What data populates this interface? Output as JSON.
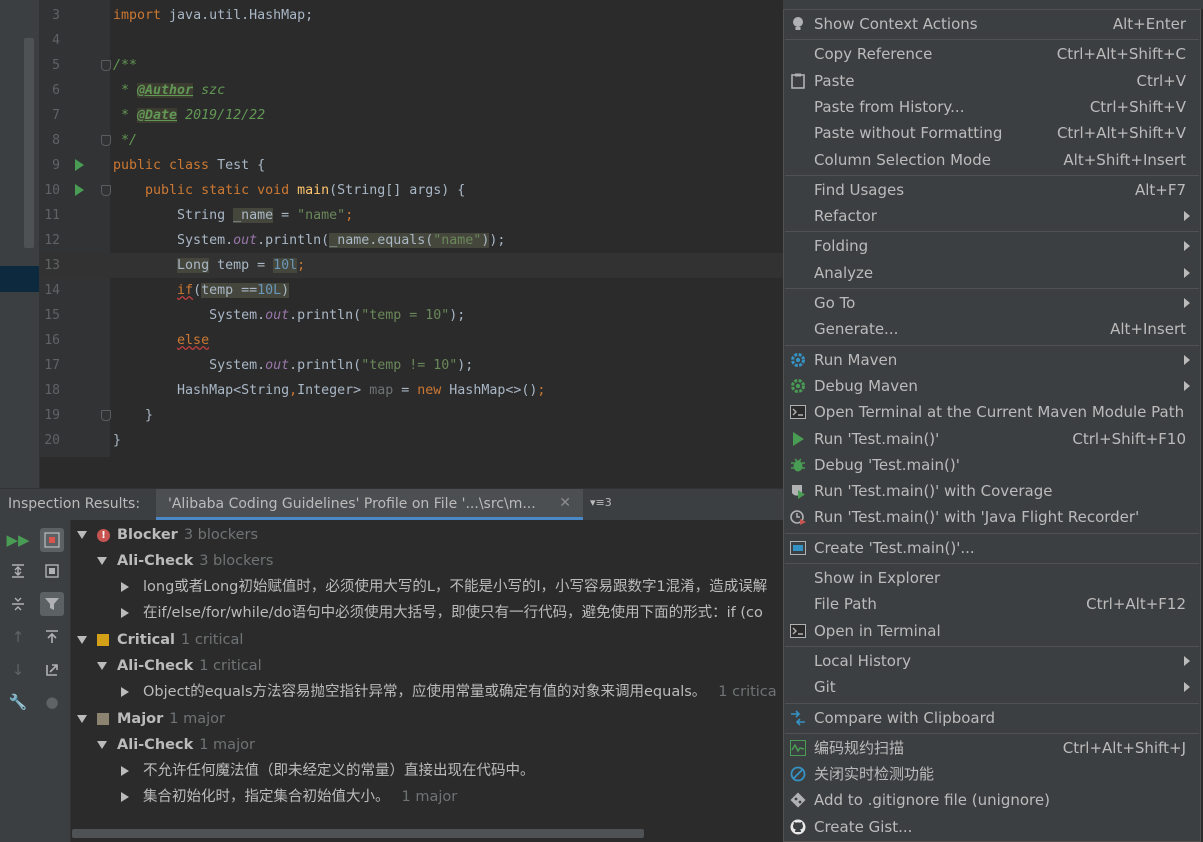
{
  "editor": {
    "lines": [
      {
        "n": "3",
        "segs": [
          [
            "kw",
            "import "
          ],
          [
            "",
            "java.util.HashMap;"
          ]
        ]
      },
      {
        "n": "4",
        "segs": []
      },
      {
        "n": "5",
        "fold": true,
        "segs": [
          [
            "cmt",
            "/**"
          ]
        ]
      },
      {
        "n": "6",
        "segs": [
          [
            "cmt",
            " * "
          ],
          [
            "tag",
            "@Author"
          ],
          [
            "cmt",
            " szc"
          ]
        ]
      },
      {
        "n": "7",
        "segs": [
          [
            "cmt",
            " * "
          ],
          [
            "tag",
            "@Date"
          ],
          [
            "cmt",
            " 2019/12/22"
          ]
        ]
      },
      {
        "n": "8",
        "fold": true,
        "segs": [
          [
            "cmt",
            " */"
          ]
        ]
      },
      {
        "n": "9",
        "run": true,
        "segs": [
          [
            "kw",
            "public class "
          ],
          [
            "",
            "Test {"
          ]
        ]
      },
      {
        "n": "10",
        "run": true,
        "fold": true,
        "segs": [
          [
            "",
            "    "
          ],
          [
            "kw",
            "public static void "
          ],
          [
            "fn",
            "main"
          ],
          [
            "",
            "(String[] args) {"
          ]
        ]
      },
      {
        "n": "11",
        "segs": [
          [
            "",
            "        String "
          ],
          [
            "warn-bg",
            "_name"
          ],
          [
            "",
            " = "
          ],
          [
            "str",
            "\"name\""
          ],
          [
            "kw",
            ";"
          ]
        ]
      },
      {
        "n": "12",
        "segs": [
          [
            "",
            "        System."
          ],
          [
            "fld",
            "out"
          ],
          [
            "",
            ".println("
          ],
          [
            "warn-bg",
            "_name.equals("
          ],
          [
            "str warn-bg",
            "\"name\""
          ],
          [
            "warn-bg",
            ")"
          ],
          [
            "",
            ");"
          ]
        ]
      },
      {
        "n": "13",
        "caret": true,
        "segs": [
          [
            "",
            "        "
          ],
          [
            "warn-bg",
            "Long"
          ],
          [
            "",
            " temp = "
          ],
          [
            "num warn-bg",
            "10l"
          ],
          [
            "kw",
            ";"
          ]
        ]
      },
      {
        "n": "14",
        "segs": [
          [
            "",
            "        "
          ],
          [
            "kw squig",
            "if"
          ],
          [
            "",
            "("
          ],
          [
            "warn-bg",
            "temp =="
          ],
          [
            "num warn-bg",
            "10L"
          ],
          [
            "warn-bg",
            ")"
          ]
        ]
      },
      {
        "n": "15",
        "segs": [
          [
            "",
            "            System."
          ],
          [
            "fld",
            "out"
          ],
          [
            "",
            ".println("
          ],
          [
            "str",
            "\"temp = 10\""
          ],
          [
            "",
            ");"
          ]
        ]
      },
      {
        "n": "16",
        "segs": [
          [
            "",
            "        "
          ],
          [
            "kw squig",
            "else"
          ]
        ]
      },
      {
        "n": "17",
        "segs": [
          [
            "",
            "            System."
          ],
          [
            "fld",
            "out"
          ],
          [
            "",
            ".println("
          ],
          [
            "str",
            "\"temp != 10\""
          ],
          [
            "",
            ");"
          ]
        ]
      },
      {
        "n": "18",
        "segs": [
          [
            "",
            "        HashMap<String"
          ],
          [
            "kw",
            ","
          ],
          [
            "",
            "Integer> "
          ],
          [
            "gray",
            "map"
          ],
          [
            "",
            " = "
          ],
          [
            "kw",
            "new "
          ],
          [
            "",
            "HashMap<>"
          ],
          [
            "",
            "()"
          ],
          [
            "kw",
            ";"
          ]
        ]
      },
      {
        "n": "19",
        "fold": true,
        "segs": [
          [
            "",
            "    }"
          ]
        ]
      },
      {
        "n": "20",
        "segs": [
          [
            "",
            "}"
          ]
        ]
      }
    ]
  },
  "inspection": {
    "header_label": "Inspection Results:",
    "tab_title": "'Alibaba Coding Guidelines' Profile on File '...\\src\\m...",
    "tab_close": "✕",
    "more_tabs": "▾≡3",
    "tree": {
      "blocker": {
        "label": "Blocker",
        "count": "3 blockers"
      },
      "blocker_group": {
        "label": "Ali-Check",
        "count": "3 blockers"
      },
      "blocker_items": [
        "long或者Long初始赋值时，必须使用大写的L，不能是小写的l，小写容易跟数字1混淆，造成误解",
        "在if/else/for/while/do语句中必须使用大括号，即使只有一行代码，避免使用下面的形式：if (co"
      ],
      "critical": {
        "label": "Critical",
        "count": "1 critical"
      },
      "critical_group": {
        "label": "Ali-Check",
        "count": "1 critical"
      },
      "critical_items": [
        {
          "text": "Object的equals方法容易抛空指针异常，应使用常量或确定有值的对象来调用equals。",
          "count": "1 critica"
        }
      ],
      "major": {
        "label": "Major",
        "count": "1 major"
      },
      "major_group": {
        "label": "Ali-Check",
        "count": "1 major"
      },
      "major_items": [
        {
          "text": "不允许任何魔法值（即未经定义的常量）直接出现在代码中。",
          "count": ""
        },
        {
          "text": "集合初始化时，指定集合初始值大小。",
          "count": "1 major"
        }
      ]
    },
    "colors": {
      "blocker": "#c75450",
      "critical": "#d4a017",
      "major": "#8c8370"
    }
  },
  "menu": {
    "items": [
      {
        "label": "Show Context Actions",
        "shortcut": "Alt+Enter",
        "icon": "bulb-icon"
      },
      {
        "sep": true
      },
      {
        "label": "Copy Reference",
        "shortcut": "Ctrl+Alt+Shift+C"
      },
      {
        "label": "Paste",
        "shortcut": "Ctrl+V",
        "icon": "clipboard-icon"
      },
      {
        "label": "Paste from History...",
        "shortcut": "Ctrl+Shift+V"
      },
      {
        "label": "Paste without Formatting",
        "shortcut": "Ctrl+Alt+Shift+V"
      },
      {
        "label": "Column Selection Mode",
        "shortcut": "Alt+Shift+Insert"
      },
      {
        "sep": true
      },
      {
        "label": "Find Usages",
        "shortcut": "Alt+F7"
      },
      {
        "label": "Refactor",
        "submenu": true
      },
      {
        "sep": true
      },
      {
        "label": "Folding",
        "submenu": true
      },
      {
        "label": "Analyze",
        "submenu": true
      },
      {
        "sep": true
      },
      {
        "label": "Go To",
        "submenu": true
      },
      {
        "label": "Generate...",
        "shortcut": "Alt+Insert"
      },
      {
        "sep": true
      },
      {
        "label": "Run Maven",
        "submenu": true,
        "icon": "maven-gear-icon"
      },
      {
        "label": "Debug Maven",
        "submenu": true,
        "icon": "maven-debug-icon"
      },
      {
        "label": "Open Terminal at the Current Maven Module Path",
        "icon": "terminal-icon"
      },
      {
        "label": "Run 'Test.main()'",
        "shortcut": "Ctrl+Shift+F10",
        "icon": "run-icon"
      },
      {
        "label": "Debug 'Test.main()'",
        "icon": "debug-icon"
      },
      {
        "label": "Run 'Test.main()' with Coverage",
        "icon": "coverage-icon"
      },
      {
        "label": "Run 'Test.main()' with 'Java Flight Recorder'",
        "icon": "profiler-icon"
      },
      {
        "sep": true
      },
      {
        "label": "Create 'Test.main()'...",
        "icon": "run-config-icon"
      },
      {
        "sep": true
      },
      {
        "label": "Show in Explorer"
      },
      {
        "label": "File Path",
        "shortcut": "Ctrl+Alt+F12"
      },
      {
        "label": "Open in Terminal",
        "icon": "terminal-icon"
      },
      {
        "sep": true
      },
      {
        "label": "Local History",
        "submenu": true
      },
      {
        "label": "Git",
        "submenu": true
      },
      {
        "sep": true
      },
      {
        "label": "Compare with Clipboard",
        "icon": "compare-icon"
      },
      {
        "sep": true
      },
      {
        "label": "编码规约扫描",
        "shortcut": "Ctrl+Alt+Shift+J",
        "icon": "scan-icon"
      },
      {
        "label": "关闭实时检测功能",
        "icon": "disable-icon"
      },
      {
        "label": "Add to .gitignore file (unignore)",
        "icon": "gitignore-icon"
      },
      {
        "label": "Create Gist...",
        "icon": "github-icon"
      }
    ]
  }
}
